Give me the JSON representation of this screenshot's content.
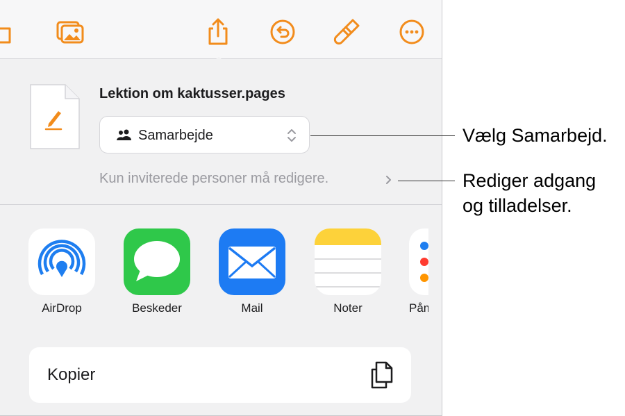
{
  "colors": {
    "accent": "#f28c1c",
    "airdrop_blue": "#1e7ef0",
    "messages_green": "#2fc84a",
    "mail_blue": "#1d7bf3",
    "notes_yellow": "#fdd23a"
  },
  "toolbar": {
    "icons": [
      "folder-icon",
      "media-icon",
      "share-icon",
      "undo-icon",
      "format-brush-icon",
      "more-icon"
    ]
  },
  "share_sheet": {
    "document_title": "Lektion om kaktusser.pages",
    "collaboration_option": "Samarbejde",
    "permissions_text": "Kun inviterede personer må redigere.",
    "apps": [
      {
        "name": "AirDrop",
        "icon": "airdrop-icon"
      },
      {
        "name": "Beskeder",
        "icon": "messages-icon"
      },
      {
        "name": "Mail",
        "icon": "mail-icon"
      },
      {
        "name": "Noter",
        "icon": "notes-icon"
      },
      {
        "name": "Påm",
        "icon": "reminders-icon"
      }
    ],
    "copy_label": "Kopier"
  },
  "callouts": {
    "collaborate": "Vælg Samarbejd.",
    "permissions_line1": "Rediger adgang",
    "permissions_line2": "og tilladelser."
  }
}
